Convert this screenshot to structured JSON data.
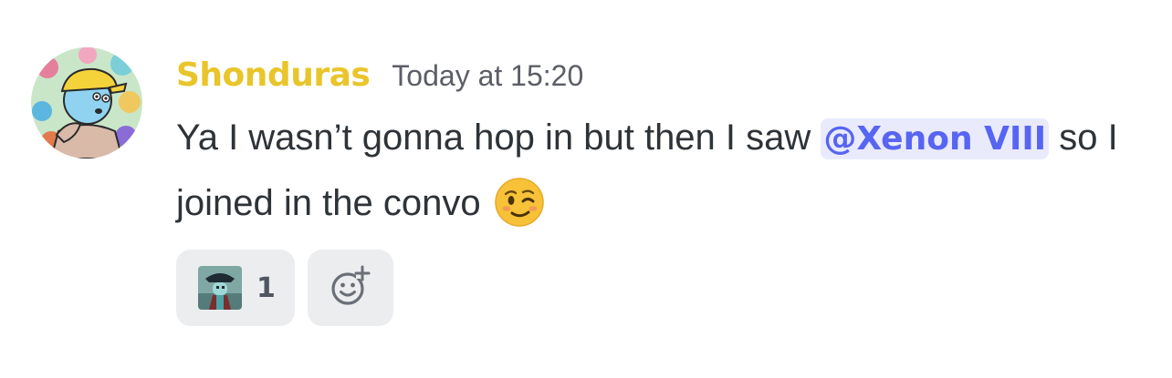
{
  "message": {
    "author": "Shonduras",
    "author_color": "#e9c52b",
    "timestamp": "Today at 15:20",
    "text_before": "Ya I wasn’t gonna hop in but then I saw ",
    "mention": "@Xenon VIII",
    "text_after": "so I joined in the convo",
    "emoji": "winking-face-emoji"
  },
  "mention_style": {
    "color": "#5865f2",
    "background": "#e9ebfd"
  },
  "reactions": [
    {
      "emoji": "pirate-character-custom-emoji",
      "count": "1"
    }
  ],
  "add_reaction": {
    "icon": "add-reaction-icon"
  }
}
